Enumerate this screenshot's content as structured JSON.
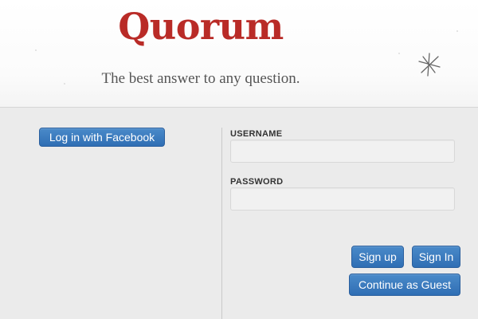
{
  "header": {
    "logo_text": "Quorum",
    "tagline": "The best answer to any question."
  },
  "left_panel": {
    "facebook_button_label": "Log in with Facebook"
  },
  "login_form": {
    "username_label": "USERNAME",
    "username_value": "",
    "password_label": "PASSWORD",
    "password_value": "",
    "signup_label": "Sign up",
    "signin_label": "Sign In",
    "guest_label": "Continue as Guest"
  },
  "colors": {
    "brand": "#b92b27",
    "button_blue": "#3a7bbf",
    "background": "#ebebeb"
  },
  "icons": {
    "decoration": "asterisk-star-icon"
  }
}
